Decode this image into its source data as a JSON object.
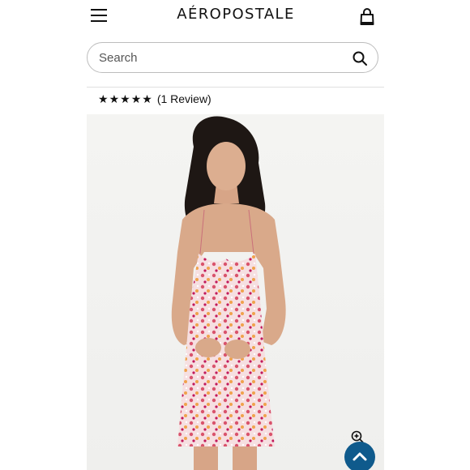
{
  "brand": {
    "logo_text": "AÉROPOSTALE"
  },
  "header": {
    "menu_icon": "hamburger-menu-icon",
    "bag_icon": "shopping-bag-icon"
  },
  "search": {
    "placeholder": "Search",
    "value": "",
    "icon": "search-icon"
  },
  "rating": {
    "stars": 5,
    "review_text": "(1 Review)"
  },
  "product_image": {
    "alt": "Floral mini dress product photo",
    "dress_colors": [
      "#f3d5d8",
      "#d9536c",
      "#f0a24b",
      "#ffffff"
    ],
    "zoom_icon": "zoom-in-icon",
    "scroll_top_icon": "chevron-up-icon"
  },
  "colors": {
    "accent": "#0f5a8c",
    "text": "#111111",
    "border": "#bdbdbd"
  }
}
